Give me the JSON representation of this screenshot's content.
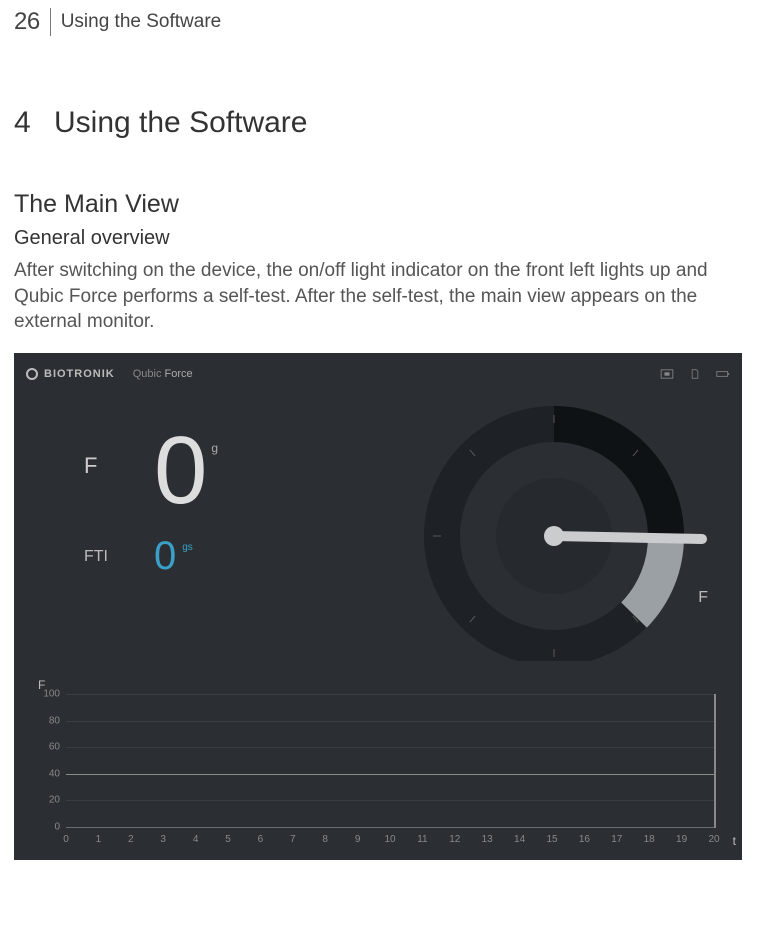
{
  "page_number": "26",
  "running_title": "Using the Software",
  "chapter": {
    "num": "4",
    "title": "Using the Software"
  },
  "section_h2": "The Main View",
  "section_h3": "General overview",
  "paragraph": "After switching on the device, the on/off light indicator on the front left lights up and Qubic Force performs a self-test. After the self-test, the main view appears on the external monitor.",
  "figure": {
    "brand": "BIOTRONIK",
    "product_a": "Qubic",
    "product_b": "Force",
    "readouts": {
      "force": {
        "label": "F",
        "value": "0",
        "unit": "g"
      },
      "fti": {
        "label": "FTI",
        "value": "0",
        "unit": "gs"
      }
    },
    "gauge": {
      "axis_label": "F"
    }
  },
  "chart_data": {
    "type": "line",
    "title": "",
    "xlabel": "t",
    "ylabel": "F",
    "ylim": [
      0,
      100
    ],
    "xlim": [
      0,
      20
    ],
    "y_ticks": [
      0,
      20,
      40,
      60,
      80,
      100
    ],
    "x_ticks": [
      0,
      1,
      2,
      3,
      4,
      5,
      6,
      7,
      8,
      9,
      10,
      11,
      12,
      13,
      14,
      15,
      16,
      17,
      18,
      19,
      20
    ],
    "series": [
      {
        "name": "Force",
        "x": [
          0,
          20
        ],
        "values": [
          40,
          40
        ]
      }
    ]
  }
}
